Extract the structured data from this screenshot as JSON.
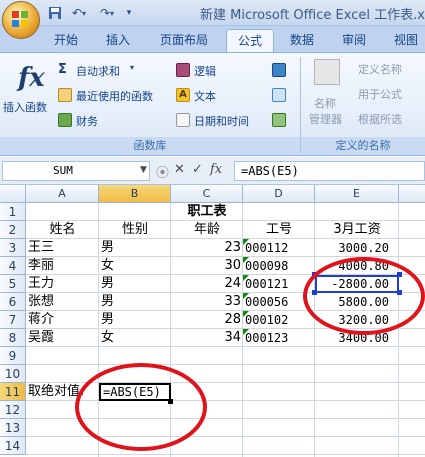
{
  "window": {
    "title": "新建 Microsoft Office Excel 工作表.xls"
  },
  "quick_access": {
    "save_icon": "save-icon",
    "undo_icon": "undo-icon",
    "redo_icon": "redo-icon",
    "customize_icon": "chevron-down-icon"
  },
  "tabs": [
    "开始",
    "插入",
    "页面布局",
    "公式",
    "数据",
    "审阅",
    "视图"
  ],
  "active_tab": "公式",
  "ribbon": {
    "insert_function": "插入函数",
    "autosum": "自动求和",
    "recent": "最近使用的函数",
    "financial": "财务",
    "logical": "逻辑",
    "text": "文本",
    "datetime": "日期和时间",
    "group1_label": "函数库",
    "name_manager_line1": "名称",
    "name_manager_line2": "管理器",
    "define_name": "定义名称",
    "use_in_formula": "用于公式",
    "create_from_selection": "根据所选",
    "group2_label": "定义的名称"
  },
  "formula_bar": {
    "name_box": "SUM",
    "formula": "=ABS(E5)"
  },
  "columns": [
    "A",
    "B",
    "C",
    "D",
    "E"
  ],
  "rows": [
    "1",
    "2",
    "3",
    "4",
    "5",
    "6",
    "7",
    "8",
    "9",
    "10",
    "11",
    "12",
    "13",
    "14"
  ],
  "sheet": {
    "title": "职工表",
    "headers": [
      "姓名",
      "性别",
      "年龄",
      "工号",
      "3月工资"
    ],
    "data": [
      [
        "王三",
        "男",
        "23",
        "000112",
        "3000.20"
      ],
      [
        "李丽",
        "女",
        "30",
        "000098",
        "4000.80"
      ],
      [
        "王力",
        "男",
        "24",
        "000121",
        "-2800.00"
      ],
      [
        "张想",
        "男",
        "33",
        "000056",
        "5800.00"
      ],
      [
        "蒋介",
        "男",
        "28",
        "000102",
        "3200.00"
      ],
      [
        "吴霞",
        "女",
        "34",
        "000123",
        "3400.00"
      ]
    ],
    "label_a11": "取绝对值:",
    "edit_b11": "=ABS(E5)"
  },
  "colors": {
    "annotation_red": "#e0121a",
    "range_blue": "#1f3fd0"
  }
}
